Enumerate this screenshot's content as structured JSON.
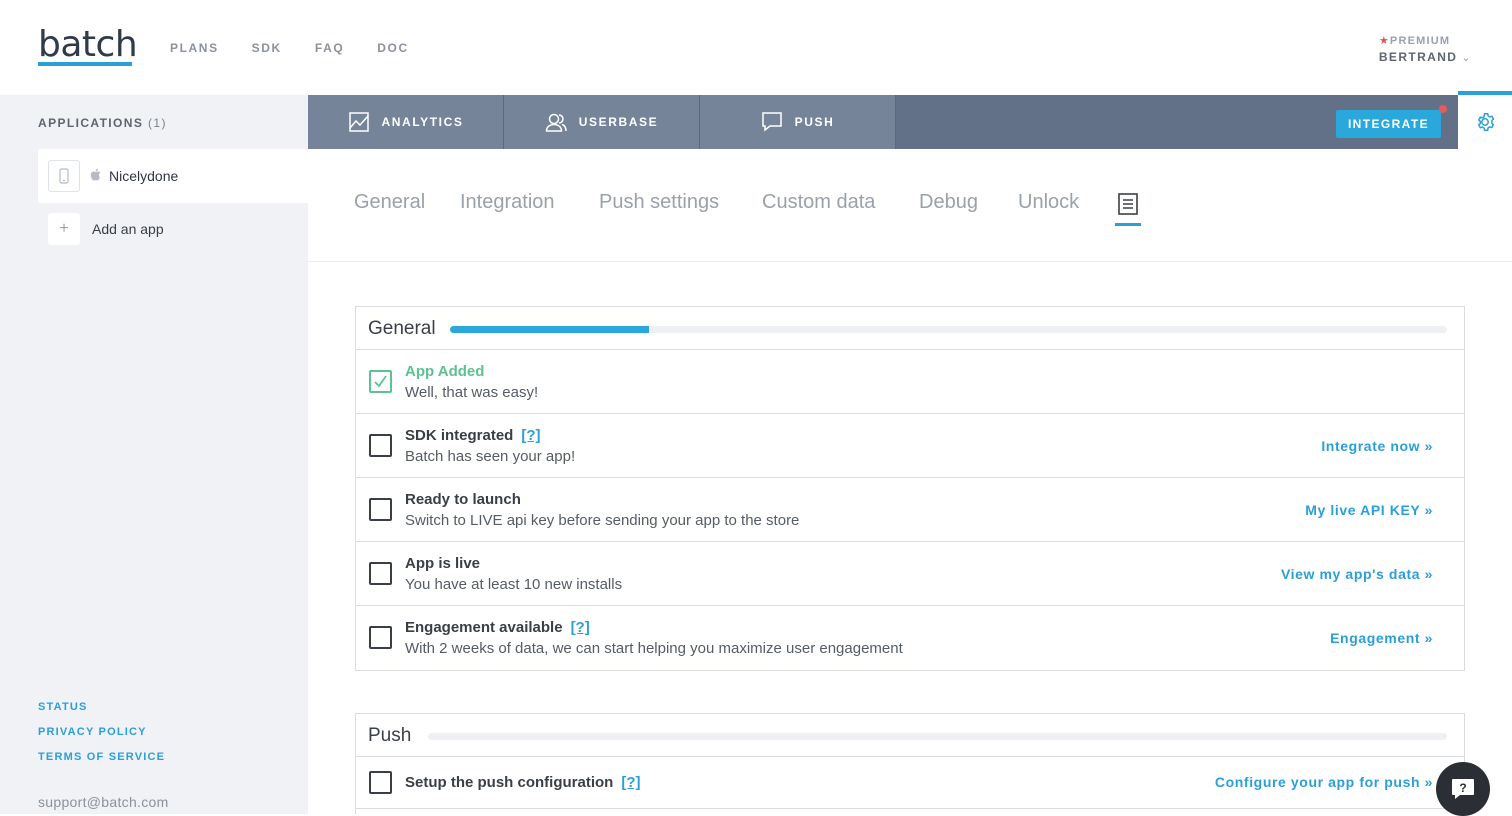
{
  "header": {
    "logo": "batch",
    "nav": [
      "PLANS",
      "SDK",
      "FAQ",
      "DOC"
    ],
    "user": {
      "plan": "PREMIUM",
      "name": "BERTRAND"
    }
  },
  "sidebar": {
    "apps_title": "APPLICATIONS",
    "apps_count": "(1)",
    "app_name": "Nicelydone",
    "add_app": "Add an app",
    "links": [
      "STATUS",
      "PRIVACY POLICY",
      "TERMS OF SERVICE"
    ],
    "support_email": "support@batch.com"
  },
  "mainnav": {
    "tabs": [
      "ANALYTICS",
      "USERBASE",
      "PUSH"
    ],
    "integrate": "INTEGRATE"
  },
  "subtabs": [
    "General",
    "Integration",
    "Push settings",
    "Custom data",
    "Debug",
    "Unlock"
  ],
  "general": {
    "title": "General",
    "progress": 0.2,
    "rows": [
      {
        "title": "App Added",
        "desc": "Well, that was easy!",
        "done": true,
        "help": "",
        "action": ""
      },
      {
        "title": "SDK integrated",
        "desc": "Batch has seen your app!",
        "done": false,
        "help": "[?]",
        "action": "Integrate now »"
      },
      {
        "title": "Ready to launch",
        "desc": "Switch to LIVE api key before sending your app to the store",
        "done": false,
        "help": "",
        "action": "My live API KEY »"
      },
      {
        "title": "App is live",
        "desc": "You have at least 10 new installs",
        "done": false,
        "help": "",
        "action": "View my app's data »"
      },
      {
        "title": "Engagement available",
        "desc": "With 2 weeks of data, we can start helping you maximize user engagement",
        "done": false,
        "help": "[?]",
        "action": "Engagement »"
      }
    ]
  },
  "push": {
    "title": "Push",
    "progress": 0,
    "rows": [
      {
        "title": "Setup the push configuration",
        "help": "[?]",
        "action": "Configure your app for push »"
      }
    ]
  },
  "colors": {
    "accent": "#2b9fd8",
    "success": "#5cc28f",
    "navbar": "#627088"
  }
}
